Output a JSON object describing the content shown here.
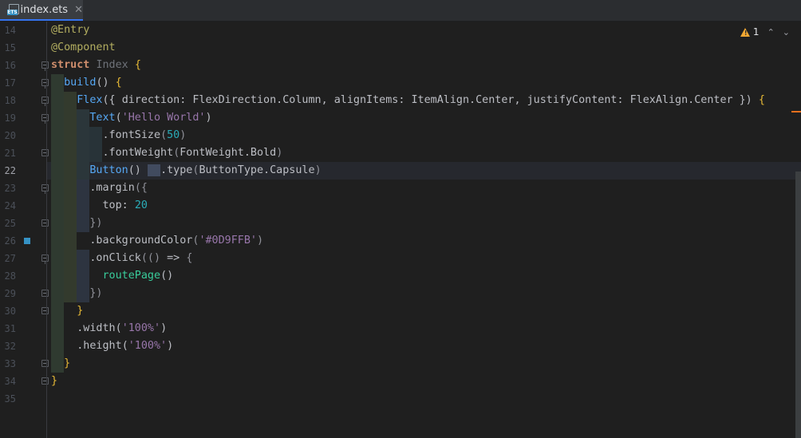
{
  "tab": {
    "label": "index.ets",
    "close": "✕",
    "badge": "ETS"
  },
  "inspections": {
    "warning_count": "1",
    "up": "⌃",
    "down": "⌄"
  },
  "line_numbers": [
    "14",
    "15",
    "16",
    "17",
    "18",
    "19",
    "20",
    "21",
    "22",
    "23",
    "24",
    "25",
    "26",
    "27",
    "28",
    "29",
    "30",
    "31",
    "32",
    "33",
    "34",
    "35"
  ],
  "current_line_index": 8,
  "code": [
    [
      [
        "ann",
        "@Entry"
      ]
    ],
    [
      [
        "ann",
        "@Component"
      ]
    ],
    [
      [
        "kw",
        "struct "
      ],
      [
        "cls",
        "Index "
      ],
      [
        "brace",
        "{"
      ]
    ],
    [
      [
        "txt",
        "  "
      ],
      [
        "meth",
        "build"
      ],
      [
        "paren",
        "() "
      ],
      [
        "brace",
        "{"
      ]
    ],
    [
      [
        "txt",
        "    "
      ],
      [
        "comp",
        "Flex"
      ],
      [
        "paren",
        "({ "
      ],
      [
        "prop",
        "direction: FlexDirection.Column, alignItems: ItemAlign.Center, justifyContent: FlexAlign.Center "
      ],
      [
        "paren",
        "}) "
      ],
      [
        "brace",
        "{"
      ]
    ],
    [
      [
        "txt",
        "      "
      ],
      [
        "comp",
        "Text"
      ],
      [
        "paren",
        "("
      ],
      [
        "str",
        "'Hello World'"
      ],
      [
        "paren",
        ")"
      ]
    ],
    [
      [
        "txt",
        "        "
      ],
      [
        "prop",
        ".fontSize"
      ],
      [
        "gray-paren",
        "("
      ],
      [
        "num",
        "50"
      ],
      [
        "gray-paren",
        ")"
      ]
    ],
    [
      [
        "txt",
        "        "
      ],
      [
        "prop",
        ".fontWeight"
      ],
      [
        "gray-paren",
        "("
      ],
      [
        "prop",
        "FontWeight.Bold"
      ],
      [
        "gray-paren",
        ")"
      ]
    ],
    [
      [
        "txt",
        "      "
      ],
      [
        "comp",
        "Button"
      ],
      [
        "paren",
        "() "
      ],
      [
        "sel",
        "  "
      ],
      [
        "prop",
        ".type"
      ],
      [
        "gray-paren",
        "("
      ],
      [
        "prop",
        "ButtonType.Capsule"
      ],
      [
        "gray-paren",
        ")"
      ]
    ],
    [
      [
        "txt",
        "      "
      ],
      [
        "prop",
        ".margin"
      ],
      [
        "gray-paren",
        "({"
      ]
    ],
    [
      [
        "txt",
        "        "
      ],
      [
        "prop",
        "top: "
      ],
      [
        "num",
        "20"
      ]
    ],
    [
      [
        "txt",
        "      "
      ],
      [
        "gray-paren",
        "})"
      ]
    ],
    [
      [
        "txt",
        "      "
      ],
      [
        "prop",
        ".backgroundColor"
      ],
      [
        "gray-paren",
        "("
      ],
      [
        "str",
        "'#0D9FFB'"
      ],
      [
        "gray-paren",
        ")"
      ]
    ],
    [
      [
        "txt",
        "      "
      ],
      [
        "prop",
        ".onClick"
      ],
      [
        "gray-paren",
        "(() "
      ],
      [
        "prop",
        "=> "
      ],
      [
        "gray-paren",
        "{"
      ]
    ],
    [
      [
        "txt",
        "        "
      ],
      [
        "fn",
        "routePage"
      ],
      [
        "paren",
        "()"
      ]
    ],
    [
      [
        "txt",
        "      "
      ],
      [
        "gray-paren",
        "})"
      ]
    ],
    [
      [
        "txt",
        "    "
      ],
      [
        "brace",
        "}"
      ]
    ],
    [
      [
        "txt",
        "    "
      ],
      [
        "prop",
        ".width"
      ],
      [
        "paren",
        "("
      ],
      [
        "str",
        "'100%'"
      ],
      [
        "paren",
        ")"
      ]
    ],
    [
      [
        "txt",
        "    "
      ],
      [
        "prop",
        ".height"
      ],
      [
        "paren",
        "("
      ],
      [
        "str",
        "'100%'"
      ],
      [
        "paren",
        ")"
      ]
    ],
    [
      [
        "txt",
        "  "
      ],
      [
        "brace",
        "}"
      ]
    ],
    [
      [
        "brace",
        "}"
      ]
    ],
    []
  ],
  "colors": {
    "accent": "#3574f0",
    "warning": "#f0a732",
    "marker": "#3592c4"
  }
}
